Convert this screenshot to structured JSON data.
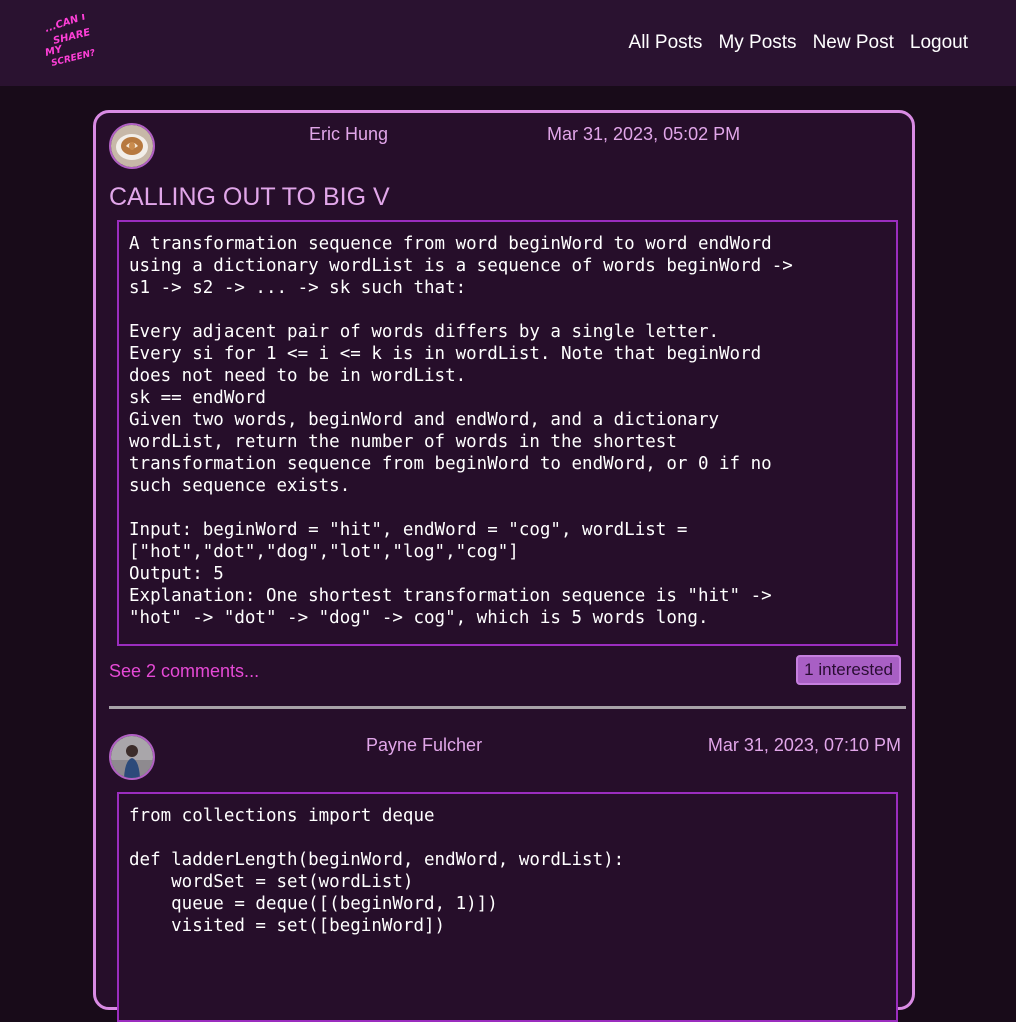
{
  "nav": {
    "logo_text": "...CAN I SHARE MY SCREEN?",
    "links": [
      "All Posts",
      "My Posts",
      "New Post",
      "Logout"
    ]
  },
  "posts": [
    {
      "author": "Eric Hung",
      "date": "Mar 31, 2023, 05:02 PM",
      "title": "CALLING OUT TO BIG V",
      "body": "A transformation sequence from word beginWord to word endWord\nusing a dictionary wordList is a sequence of words beginWord ->\ns1 -> s2 -> ... -> sk such that:\n\nEvery adjacent pair of words differs by a single letter.\nEvery si for 1 <= i <= k is in wordList. Note that beginWord\ndoes not need to be in wordList.\nsk == endWord\nGiven two words, beginWord and endWord, and a dictionary\nwordList, return the number of words in the shortest\ntransformation sequence from beginWord to endWord, or 0 if no\nsuch sequence exists.\n\nInput: beginWord = \"hit\", endWord = \"cog\", wordList =\n[\"hot\",\"dot\",\"dog\",\"lot\",\"log\",\"cog\"]\nOutput: 5\nExplanation: One shortest transformation sequence is \"hit\" ->\n\"hot\" -> \"dot\" -> \"dog\" -> cog\", which is 5 words long.",
      "comments_link": "See 2 comments...",
      "interested": "1 interested"
    },
    {
      "author": "Payne Fulcher",
      "date": "Mar 31, 2023, 07:10 PM",
      "body": "from collections import deque\n\ndef ladderLength(beginWord, endWord, wordList):\n    wordSet = set(wordList)\n    queue = deque([(beginWord, 1)])\n    visited = set([beginWord])"
    }
  ],
  "colors": {
    "page_bg": "#180b19",
    "nav_bg": "#2a1230",
    "card_border": "#d98be4",
    "accent_text": "#e1a6e9",
    "link": "#e64ad6",
    "code_border": "#9b2dbf",
    "badge_bg": "#a85fc4"
  }
}
